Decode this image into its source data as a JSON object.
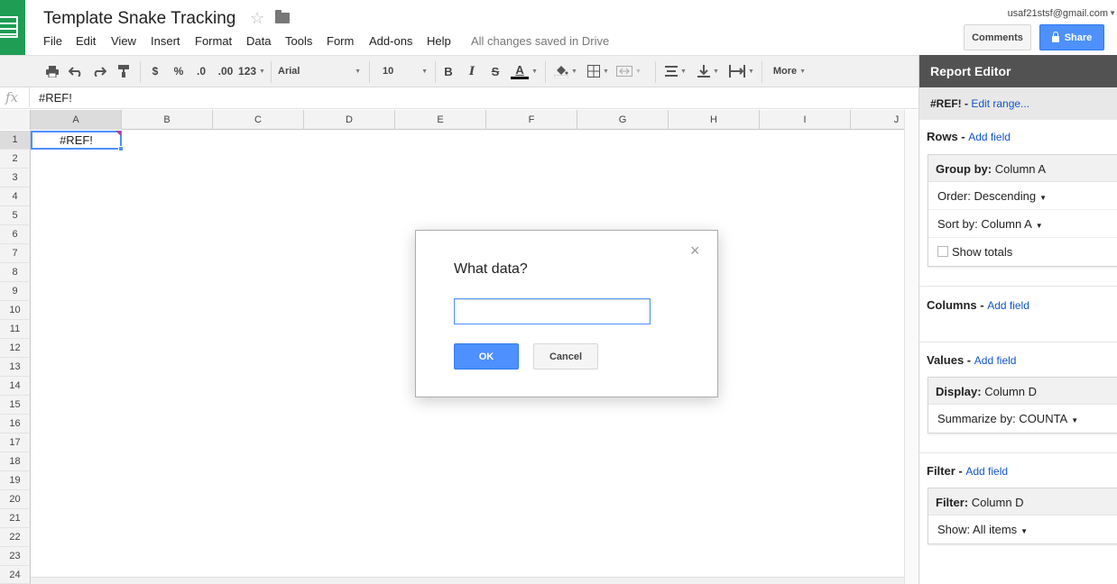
{
  "app": {
    "title": "Template Snake Tracking",
    "status": "All changes saved in Drive",
    "user_email": "usaf21stsf@gmail.com",
    "comments_label": "Comments",
    "share_label": "Share"
  },
  "menu": [
    "File",
    "Edit",
    "View",
    "Insert",
    "Format",
    "Data",
    "Tools",
    "Form",
    "Add-ons",
    "Help"
  ],
  "toolbar": {
    "currency": "$",
    "percent": "%",
    "dec_decrease": ".0",
    "dec_increase": ".00",
    "number_format": "123",
    "font": "Arial",
    "font_size": "10",
    "bold": "B",
    "italic": "I",
    "strike": "S",
    "text_color": "A",
    "more": "More"
  },
  "formula_bar": {
    "fx": "fx",
    "value": "#REF!"
  },
  "grid": {
    "columns": [
      "A",
      "B",
      "C",
      "D",
      "E",
      "F",
      "G",
      "H",
      "I",
      "J"
    ],
    "rows": [
      "1",
      "2",
      "3",
      "4",
      "5",
      "6",
      "7",
      "8",
      "9",
      "10",
      "11",
      "12",
      "13",
      "14",
      "15",
      "16",
      "17",
      "18",
      "19",
      "20",
      "21",
      "22",
      "23",
      "24"
    ],
    "a1_value": "#REF!"
  },
  "dialog": {
    "title": "What data?",
    "input_value": "",
    "ok_label": "OK",
    "cancel_label": "Cancel",
    "close_glyph": "×"
  },
  "report_editor": {
    "title": "Report Editor",
    "range_label": "#REF! -",
    "edit_range": "Edit range...",
    "rows": {
      "label": "Rows -",
      "add": "Add field",
      "group_by_key": "Group by:",
      "group_by_value": "Column A",
      "order": "Order: Descending",
      "sort": "Sort by: Column A",
      "show_totals": "Show totals"
    },
    "columns": {
      "label": "Columns -",
      "add": "Add field"
    },
    "values": {
      "label": "Values -",
      "add": "Add field",
      "display_key": "Display:",
      "display_value": "Column D",
      "summarize": "Summarize by: COUNTA"
    },
    "filter": {
      "label": "Filter -",
      "add": "Add field",
      "filter_key": "Filter:",
      "filter_value": "Column D",
      "show": "Show: All items"
    }
  },
  "colors": {
    "accent": "#4d90fe",
    "sheets_green": "#1f9d55",
    "panel_header": "#525252",
    "link": "#1155cc"
  }
}
